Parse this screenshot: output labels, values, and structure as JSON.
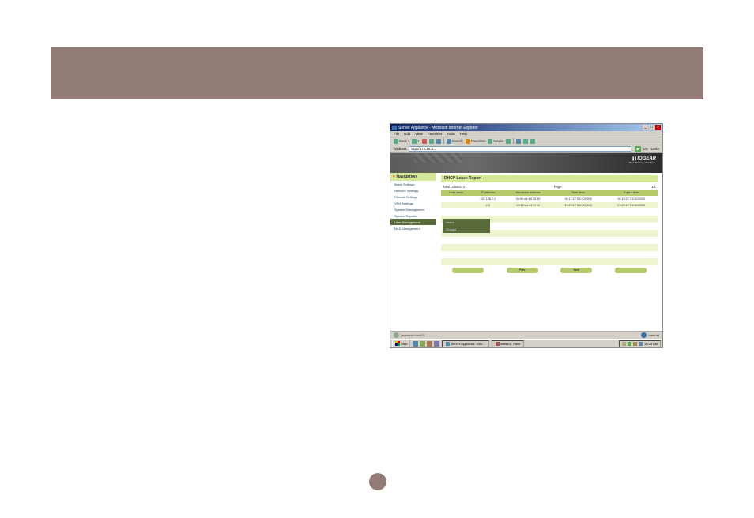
{
  "window": {
    "title": "Server Appliance - Microsoft Internet Explorer"
  },
  "menubar": [
    "File",
    "Edit",
    "View",
    "Favorites",
    "Tools",
    "Help"
  ],
  "toolbar": {
    "back": "Back",
    "search": "Search",
    "favorites": "Favorites",
    "media": "Media"
  },
  "addressbar": {
    "label": "Address",
    "value": "http://172.16.1.1",
    "go": "Go",
    "links": "Links"
  },
  "brand": {
    "name": "IOGEAR",
    "tagline": "New Thinking. New Style."
  },
  "nav": {
    "header": "Navigation",
    "items": [
      "Basic Settings",
      "Network Settings",
      "Firewall Settings",
      "VPN Settings",
      "System Management",
      "System Reports",
      "User Management",
      "NAS Management"
    ]
  },
  "submenu": {
    "users": "Users",
    "groups": "Groups"
  },
  "panel": {
    "title": "DHCP Lease Report",
    "total_label": "Total Leases:",
    "total_value": "2",
    "page_label": "Page:",
    "page_value": "1/1",
    "cols": [
      "Host name",
      "IP address",
      "Hardware address",
      "Start time",
      "Expire time"
    ],
    "rows": [
      {
        "host": "",
        "ip": "192.168.2.2",
        "hw": "00:50:e4:60:26:59",
        "start": "16:17:27 01/10/2000",
        "exp": "16:18:27 01/10/2000"
      },
      {
        "host": "",
        "ip": "2.3",
        "hw": "00:10:a4:04:f9:90",
        "start": "13:22:17 01/10/2000",
        "exp": "23:22:17 01/10/2000"
      }
    ],
    "pager": {
      "prev": "Prev",
      "next": "Next"
    }
  },
  "statusbar": {
    "text": "javascript:void(0);",
    "zone": "Internet"
  },
  "taskbar": {
    "start": "Start",
    "apps": [
      "Server Appliance - Mic...",
      "untitled - Paint"
    ],
    "clock": "10:29 AM"
  }
}
